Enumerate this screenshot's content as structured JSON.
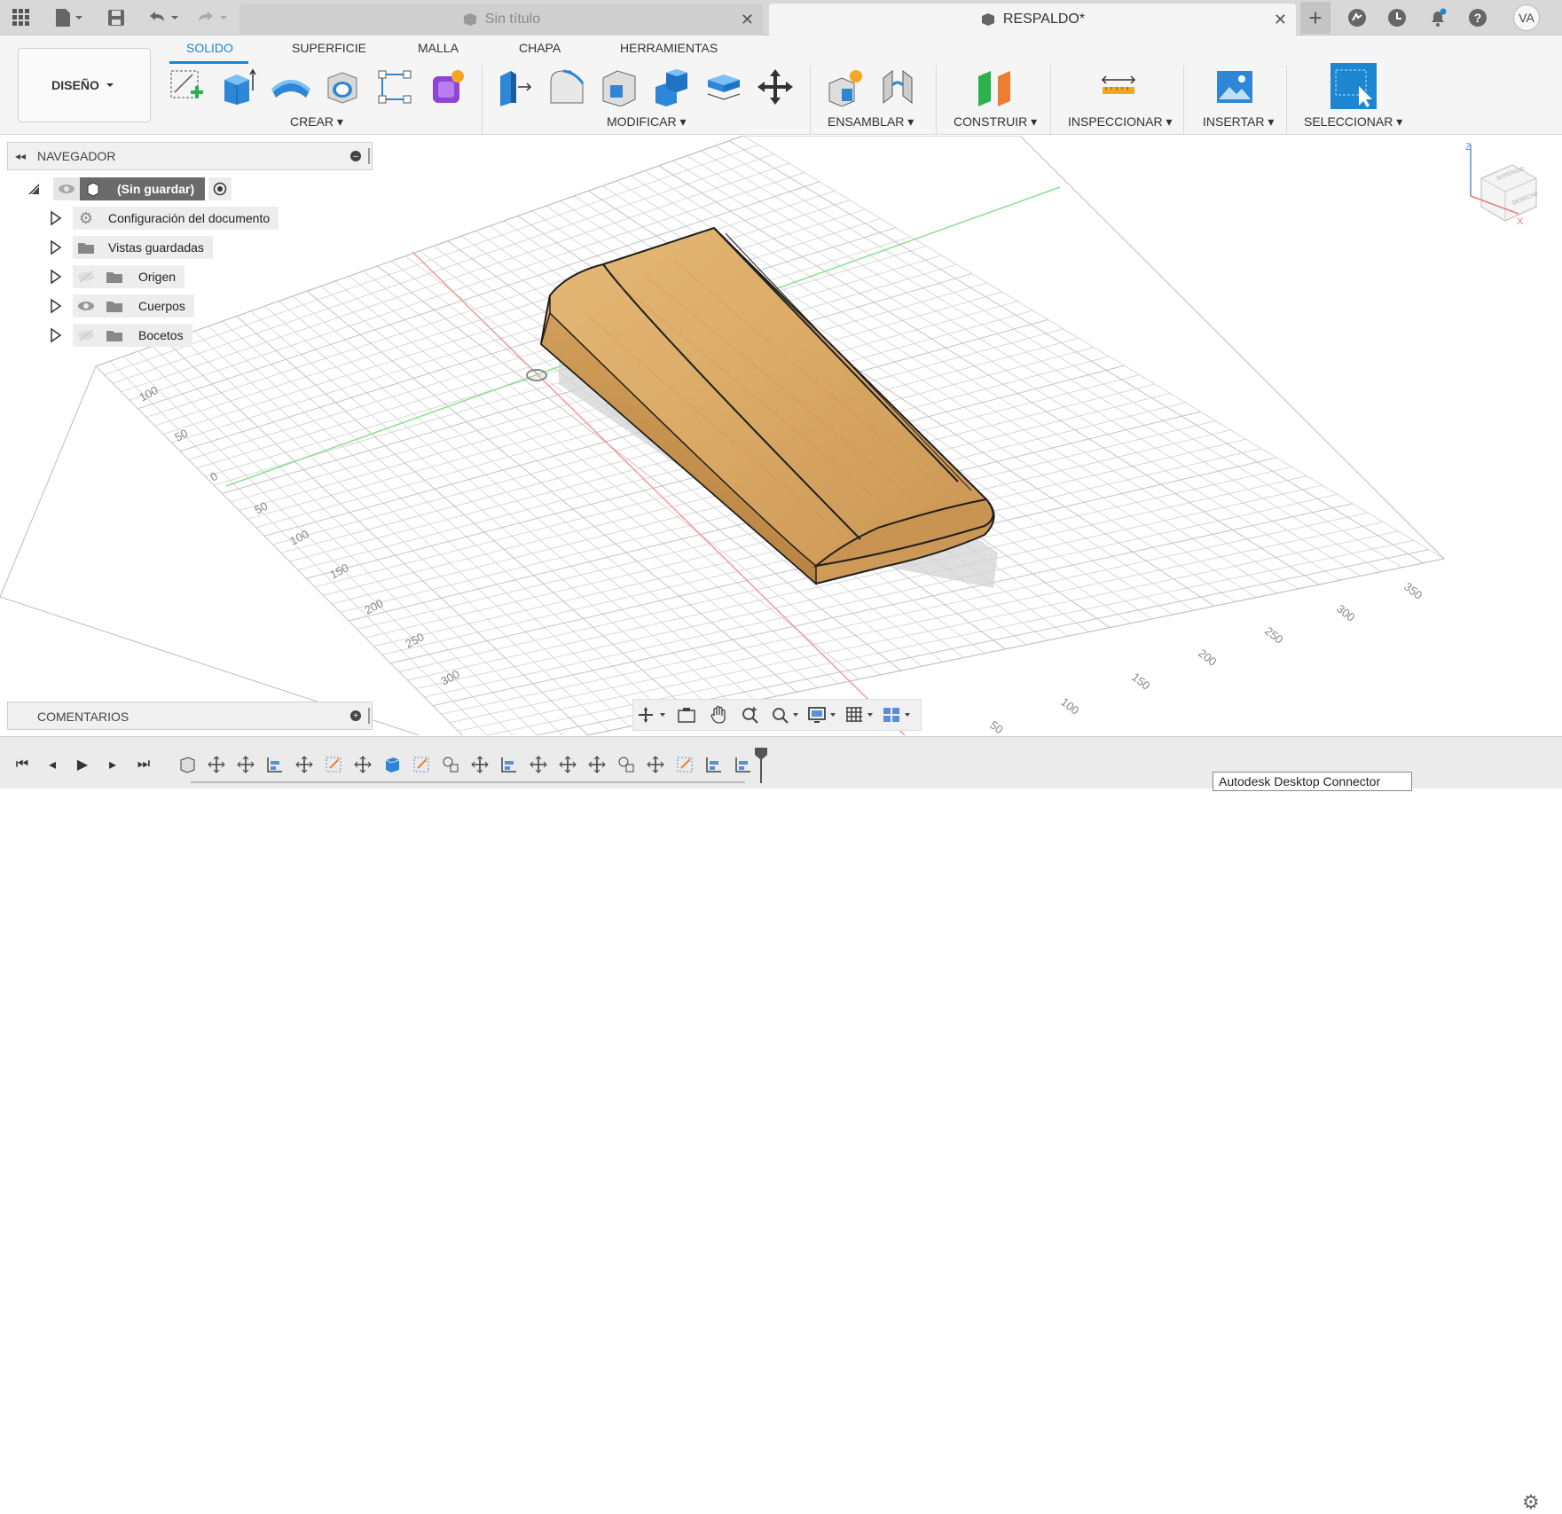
{
  "titlebar": {
    "tabs": [
      {
        "label": "Sin título",
        "active": false
      },
      {
        "label": "RESPALDO*",
        "active": true
      }
    ],
    "avatar_initials": "VA",
    "icons": [
      "apps-grid-icon",
      "file-icon",
      "save-icon",
      "undo-icon",
      "redo-icon",
      "new-tab-plus-icon",
      "extensions-icon",
      "job-status-icon",
      "notifications-icon",
      "help-icon"
    ]
  },
  "ribbon": {
    "workspace_label": "DISEÑO",
    "tabs": [
      "SOLIDO",
      "SUPERFICIE",
      "MALLA",
      "CHAPA",
      "HERRAMIENTAS"
    ],
    "active_tab": "SOLIDO",
    "groups": [
      "CREAR",
      "MODIFICAR",
      "ENSAMBLAR",
      "CONSTRUIR",
      "INSPECCIONAR",
      "INSERTAR",
      "SELECCIONAR"
    ],
    "accent": "#1d86d1"
  },
  "navigator": {
    "title": "NAVEGADOR",
    "root": "(Sin guardar)",
    "items": [
      {
        "label": "Configuración del documento",
        "icon": "gear-icon"
      },
      {
        "label": "Vistas guardadas",
        "icon": "folder-icon"
      },
      {
        "label": "Origen",
        "icon": "folder-icon",
        "visible": false
      },
      {
        "label": "Cuerpos",
        "icon": "folder-icon",
        "visible": true
      },
      {
        "label": "Bocetos",
        "icon": "folder-icon",
        "visible": false
      }
    ]
  },
  "comments": {
    "title": "COMENTARIOS"
  },
  "viewcube": {
    "labels": [
      "Z",
      "X",
      "SUPERIOR",
      "DERECHA"
    ]
  },
  "grid_labels": {
    "left_axis": [
      "100",
      "50",
      "0",
      "50",
      "100",
      "150",
      "200",
      "250",
      "300"
    ],
    "right_axis": [
      "350",
      "300",
      "250",
      "200",
      "150",
      "100",
      "50"
    ]
  },
  "model": {
    "body_color": "#d9a864",
    "edge_color": "#1e1e1e"
  },
  "tooltip": "Autodesk Desktop Connector"
}
